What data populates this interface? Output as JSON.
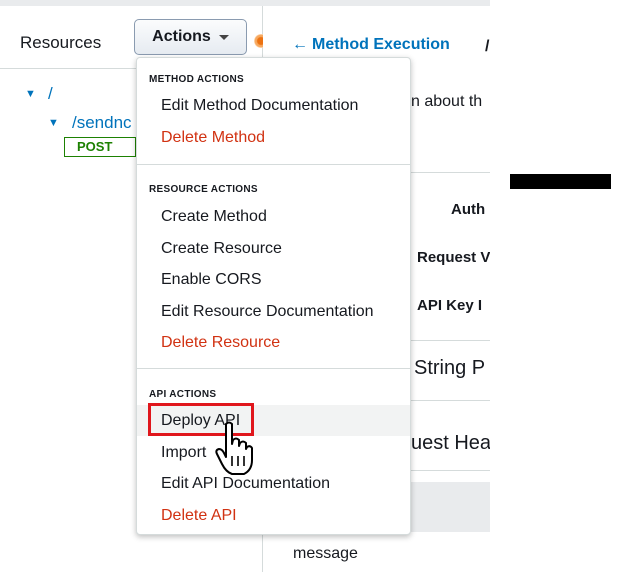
{
  "sidebar": {
    "title": "Resources",
    "actions_button": "Actions",
    "tree": [
      {
        "label": "/"
      },
      {
        "label": "/sendnc"
      }
    ],
    "method_badge": "POST"
  },
  "main": {
    "back_link": "Method Execution",
    "back_link_trailing": "/",
    "background_text": [
      "n about th",
      "Auth",
      "Request V",
      "API Key I",
      "String P",
      "uest Hea",
      "message"
    ]
  },
  "actions_menu": {
    "sections": [
      {
        "label": "METHOD ACTIONS",
        "items": [
          {
            "label": "Edit Method Documentation",
            "danger": false
          },
          {
            "label": "Delete Method",
            "danger": true
          }
        ]
      },
      {
        "label": "RESOURCE ACTIONS",
        "items": [
          {
            "label": "Create Method",
            "danger": false
          },
          {
            "label": "Create Resource",
            "danger": false
          },
          {
            "label": "Enable CORS",
            "danger": false
          },
          {
            "label": "Edit Resource Documentation",
            "danger": false
          },
          {
            "label": "Delete Resource",
            "danger": true
          }
        ]
      },
      {
        "label": "API ACTIONS",
        "items": [
          {
            "label": "Deploy API",
            "danger": false,
            "highlighted": true
          },
          {
            "label": "Import",
            "danger": false
          },
          {
            "label": "Edit API Documentation",
            "danger": false
          },
          {
            "label": "Delete API",
            "danger": true
          }
        ]
      }
    ]
  },
  "colors": {
    "link": "#0073bb",
    "danger": "#d13212",
    "highlight_box": "#e0161c",
    "post_badge": "#1d8102"
  },
  "icons": [
    "caret-down-icon",
    "expand-arrow-icon",
    "back-arrow-icon",
    "hand-pointer-icon",
    "status-dot-icon"
  ]
}
